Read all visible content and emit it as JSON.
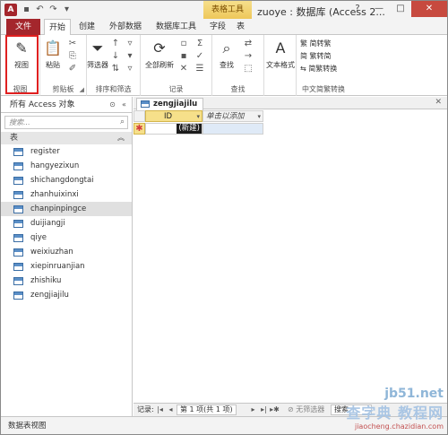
{
  "titlebar": {
    "app_icon": "A",
    "qat": [
      "save-icon",
      "undo-icon",
      "redo-icon",
      "customize-icon"
    ],
    "context_tab_group": "表格工具",
    "window_title": "zuoye : 数据库 (Access 2...",
    "controls": [
      "?",
      "—",
      "□",
      "✕"
    ]
  },
  "tabs": {
    "file": "文件",
    "items": [
      "开始",
      "创建",
      "外部数据",
      "数据库工具",
      "字段",
      "表"
    ]
  },
  "ribbon": {
    "view": {
      "label": "视图",
      "group": "视图"
    },
    "clipboard": {
      "paste": "粘贴",
      "group": "剪贴板"
    },
    "sort_filter": {
      "filter": "筛选器",
      "group": "排序和筛选"
    },
    "records": {
      "refresh": "全部刷新",
      "group": "记录"
    },
    "find": {
      "find": "查找",
      "group": "查找"
    },
    "text": {
      "format": "文本格式"
    },
    "chinese": {
      "to_traditional": "简转繁",
      "to_simplified": "繁转简",
      "convert": "简繁转换",
      "group": "中文简繁转换"
    }
  },
  "nav": {
    "header": "所有 Access 对象",
    "search_placeholder": "搜索...",
    "group": "表",
    "tables": [
      "register",
      "hangyezixun",
      "shichangdongtai",
      "zhanhuixinxi",
      "chanpinpingce",
      "duijiangji",
      "qiye",
      "weixiuzhan",
      "xiepinruanjian",
      "zhishiku",
      "zengjiajilu"
    ],
    "selected_index": 4
  },
  "doc": {
    "tab_label": "zengjiajilu",
    "columns": {
      "id": "ID",
      "add": "单击以添加"
    },
    "new_row_marker": "✱",
    "new_row_value": "(新建)"
  },
  "recnav": {
    "label": "记录:",
    "position": "第 1 项(共 1 项)",
    "filter": "无筛选器",
    "search": "搜索"
  },
  "status": {
    "text": "数据表视图"
  },
  "watermark": {
    "top": "jb51.net",
    "main": "查字典 教程网",
    "url": "jiaocheng.chazidian.com"
  }
}
